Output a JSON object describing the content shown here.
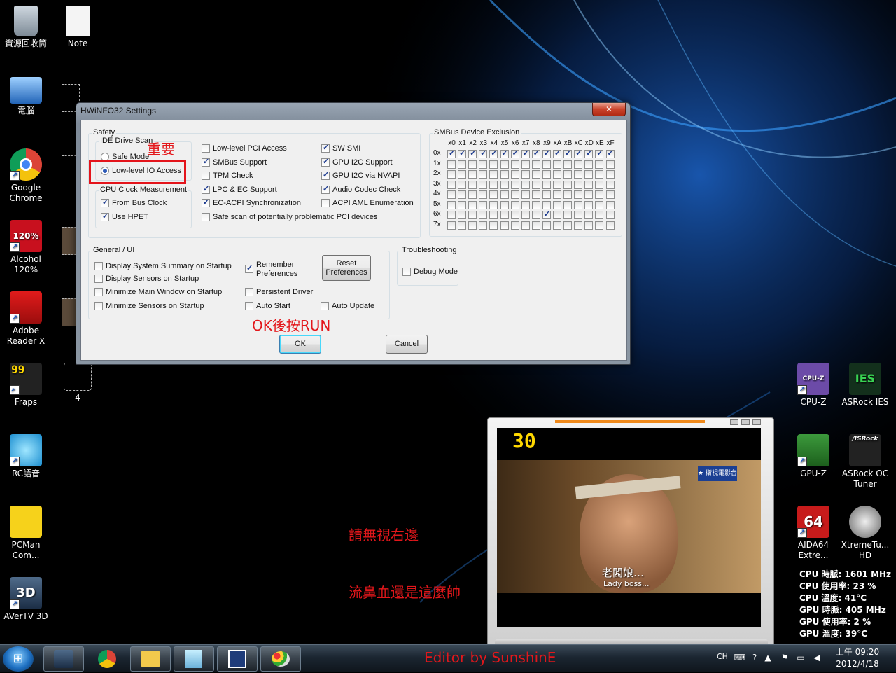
{
  "desktop": {
    "left_icons": [
      {
        "label": "資源回收筒"
      },
      {
        "label": "Note"
      },
      {
        "label": "電腦"
      },
      {
        "label": "Google Chrome"
      },
      {
        "label": "Alcohol 120%"
      },
      {
        "label": "Adobe Reader X"
      },
      {
        "label": "Fraps"
      },
      {
        "label": "4"
      },
      {
        "label": "RC語音"
      },
      {
        "label": "PCMan Com..."
      },
      {
        "label": "AVerTV 3D"
      }
    ],
    "right_icons": [
      {
        "label": "CPU-Z"
      },
      {
        "label": "ASRock IES"
      },
      {
        "label": "GPU-Z"
      },
      {
        "label": "ASRock OC Tuner"
      },
      {
        "label": "AIDA64 Extre..."
      },
      {
        "label": "XtremeTu... HD"
      }
    ],
    "icon_glyphs": {
      "alcohol": "120%",
      "fraps": "99",
      "aida": "64",
      "avertv": "3D",
      "cpuz": "CPU-Z",
      "ies": "IES",
      "asrock": "/ISRock"
    }
  },
  "window": {
    "title": "HWiNFO32 Settings",
    "close_glyph": "✕",
    "safety": {
      "title": "Safety",
      "ide_scan": {
        "title": "IDE Drive Scan",
        "options": [
          {
            "label": "Safe Mode",
            "checked": false
          },
          {
            "label": "Low-level IO Access",
            "checked": true
          }
        ]
      },
      "cpu_clock": {
        "title": "CPU Clock Measurement",
        "options": [
          {
            "label": "From Bus Clock",
            "checked": true
          },
          {
            "label": "Use HPET",
            "checked": true
          }
        ]
      },
      "col1": [
        {
          "label": "Low-level PCI Access",
          "checked": false
        },
        {
          "label": "SMBus Support",
          "checked": true
        },
        {
          "label": "TPM Check",
          "checked": false
        },
        {
          "label": "LPC & EC Support",
          "checked": true
        },
        {
          "label": "EC-ACPI Synchronization",
          "checked": true
        },
        {
          "label": "Safe scan of potentially problematic PCI devices",
          "checked": false
        }
      ],
      "col2": [
        {
          "label": "SW SMI",
          "checked": true
        },
        {
          "label": "GPU I2C Support",
          "checked": true
        },
        {
          "label": "GPU I2C via NVAPI",
          "checked": true
        },
        {
          "label": "Audio Codec Check",
          "checked": true
        },
        {
          "label": "ACPI AML Enumeration",
          "checked": false
        }
      ]
    },
    "smbus": {
      "title": "SMBus Device Exclusion",
      "columns": [
        "x0",
        "x1",
        "x2",
        "x3",
        "x4",
        "x5",
        "x6",
        "x7",
        "x8",
        "x9",
        "xA",
        "xB",
        "xC",
        "xD",
        "xE",
        "xF"
      ],
      "rows": [
        "0x",
        "1x",
        "2x",
        "3x",
        "4x",
        "5x",
        "6x",
        "7x"
      ],
      "checked_cells": [
        [
          0,
          0
        ],
        [
          0,
          1
        ],
        [
          0,
          2
        ],
        [
          0,
          3
        ],
        [
          0,
          4
        ],
        [
          0,
          5
        ],
        [
          0,
          6
        ],
        [
          0,
          7
        ],
        [
          0,
          8
        ],
        [
          0,
          9
        ],
        [
          0,
          10
        ],
        [
          0,
          11
        ],
        [
          0,
          12
        ],
        [
          0,
          13
        ],
        [
          0,
          14
        ],
        [
          0,
          15
        ],
        [
          6,
          9
        ]
      ]
    },
    "general": {
      "title": "General / UI",
      "col1": [
        {
          "label": "Display System Summary on Startup",
          "checked": false
        },
        {
          "label": "Display Sensors on Startup",
          "checked": false
        },
        {
          "label": "Minimize Main Window on Startup",
          "checked": false
        },
        {
          "label": "Minimize Sensors on Startup",
          "checked": false
        }
      ],
      "remember": {
        "label_line1": "Remember",
        "label_line2": "Preferences",
        "checked": true
      },
      "persistent": {
        "label": "Persistent Driver",
        "checked": false
      },
      "autostart": {
        "label": "Auto Start",
        "checked": false
      },
      "autoupdate": {
        "label": "Auto Update",
        "checked": false
      },
      "reset_line1": "Reset",
      "reset_line2": "Preferences"
    },
    "troubleshooting": {
      "title": "Troubleshooting",
      "debug": {
        "label": "Debug Mode",
        "checked": false
      }
    },
    "ok_label": "OK",
    "cancel_label": "Cancel"
  },
  "annotations": {
    "important": "重要",
    "ok_then_run": "OK後按RUN",
    "ignore_right": "請無視右邊",
    "nosebleed": "流鼻血還是這麼帥",
    "editor": "Editor by SunshinE"
  },
  "player": {
    "channel": "30",
    "channel_logo": "★ 衛視電影台",
    "subtitle_cn": "老闆娘…",
    "subtitle_en": "Lady boss..."
  },
  "stats": [
    "CPU 時脈: 1601 MHz",
    "CPU 使用率: 23 %",
    "CPU 溫度: 41°C",
    "GPU 時脈: 405 MHz",
    "GPU 使用率: 2 %",
    "GPU 溫度: 39°C"
  ],
  "taskbar": {
    "start_glyph": "⊞",
    "ime": "CH",
    "clock_line1": "上午 09:20",
    "clock_line2": "2012/4/18"
  }
}
